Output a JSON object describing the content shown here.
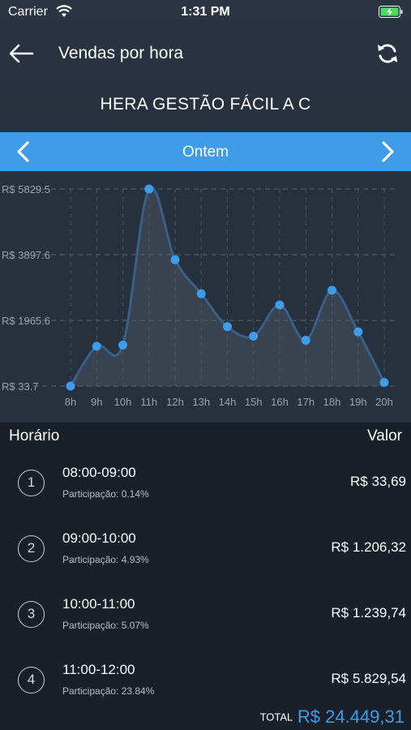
{
  "status_bar": {
    "carrier": "Carrier",
    "time": "1:31 PM"
  },
  "navbar": {
    "title": "Vendas por hora",
    "back_icon": "arrow-left-icon",
    "refresh_icon": "refresh-icon"
  },
  "company": "HERA GESTÃO FÁCIL A C",
  "day_selector": {
    "label": "Ontem",
    "prev_icon": "chevron-left-icon",
    "next_icon": "chevron-right-icon"
  },
  "colors": {
    "accent": "#3e9ce9",
    "header_bg": "#27303d",
    "list_bg": "#1a2029"
  },
  "chart_data": {
    "type": "area",
    "x": [
      "8h",
      "9h",
      "10h",
      "11h",
      "12h",
      "13h",
      "14h",
      "15h",
      "16h",
      "17h",
      "18h",
      "19h",
      "20h"
    ],
    "values": [
      33.69,
      1206.32,
      1239.74,
      5829.54,
      3750,
      2750,
      1780,
      1500,
      2420,
      1380,
      2850,
      1630,
      140
    ],
    "ytick_labels": [
      "R$ 5829.5",
      "R$ 3897.6",
      "R$ 1965.6",
      "R$ 33.7"
    ],
    "ytick_values": [
      5829.5,
      3897.6,
      1965.6,
      33.7
    ],
    "ylim": [
      33.7,
      5829.5
    ],
    "grid": true
  },
  "list": {
    "header_left": "Horário",
    "header_right": "Valor",
    "rows": [
      {
        "n": "1",
        "range": "08:00-09:00",
        "participation": "Participação: 0.14%",
        "value": "R$ 33,69"
      },
      {
        "n": "2",
        "range": "09:00-10:00",
        "participation": "Participação: 4.93%",
        "value": "R$ 1.206,32"
      },
      {
        "n": "3",
        "range": "10:00-11:00",
        "participation": "Participação: 5.07%",
        "value": "R$ 1.239,74"
      },
      {
        "n": "4",
        "range": "11:00-12:00",
        "participation": "Participação: 23.84%",
        "value": "R$ 5.829,54"
      }
    ],
    "total_label": "TOTAL",
    "total_value": "R$ 24.449,31"
  }
}
